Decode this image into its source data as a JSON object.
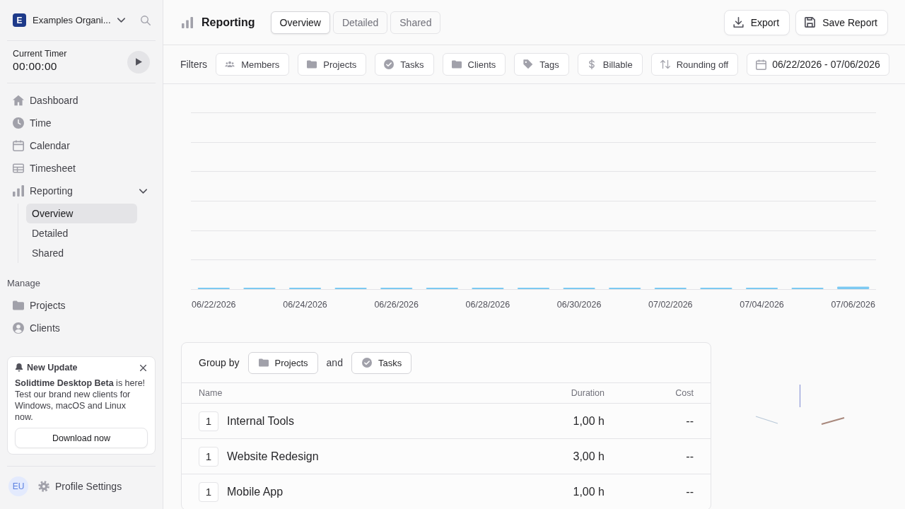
{
  "sidebar": {
    "organization": {
      "initial": "E",
      "name": "Examples Organi..."
    },
    "timer": {
      "label": "Current Timer",
      "time": "00:00:00"
    },
    "nav": [
      {
        "label": "Dashboard",
        "selected": false
      },
      {
        "label": "Time",
        "selected": false
      },
      {
        "label": "Calendar",
        "selected": false
      },
      {
        "label": "Timesheet",
        "selected": false
      },
      {
        "label": "Reporting",
        "selected": false,
        "expanded": true,
        "children": [
          {
            "label": "Overview",
            "selected": true
          },
          {
            "label": "Detailed",
            "selected": false
          },
          {
            "label": "Shared",
            "selected": false
          }
        ]
      }
    ],
    "manage": {
      "heading": "Manage",
      "items": [
        {
          "label": "Projects",
          "selected": false
        },
        {
          "label": "Clients",
          "selected": false
        }
      ]
    },
    "update_card": {
      "title": "New Update",
      "message": "**Solidtime Desktop Beta** is here! Test our brand new clients for Windows, macOS and Linux now.",
      "button": "Download now"
    },
    "footer": {
      "avatar": "EU",
      "label": "Profile Settings"
    }
  },
  "header": {
    "title": "Reporting",
    "tabs": [
      {
        "label": "Overview",
        "selected": true
      },
      {
        "label": "Detailed",
        "selected": false
      },
      {
        "label": "Shared",
        "selected": false
      }
    ],
    "actions": [
      "Export",
      "Save Report"
    ]
  },
  "filters": {
    "label": "Filters",
    "buttons": [
      "Members",
      "Projects",
      "Tasks",
      "Clients",
      "Tags",
      "Billable",
      "Rounding off"
    ],
    "date_range": "06/22/2026 - 07/06/2026"
  },
  "chart": {
    "date_labels": [
      "06/22/2026",
      "06/24/2026",
      "06/26/2026",
      "06/28/2026",
      "06/30/2026",
      "07/02/2026",
      "07/04/2026",
      "07/06/2026"
    ]
  },
  "report": {
    "group_by": {
      "label": "Group by",
      "first": "Projects",
      "joiner": "and",
      "second": "Tasks"
    },
    "columns": [
      "Name",
      "Duration",
      "Cost"
    ],
    "rows": [
      {
        "count": "1",
        "name": "Internal Tools",
        "duration": "1,00 h",
        "cost": "--"
      },
      {
        "count": "1",
        "name": "Website Redesign",
        "duration": "3,00 h",
        "cost": "--"
      },
      {
        "count": "1",
        "name": "Mobile App",
        "duration": "1,00 h",
        "cost": "--"
      }
    ]
  }
}
